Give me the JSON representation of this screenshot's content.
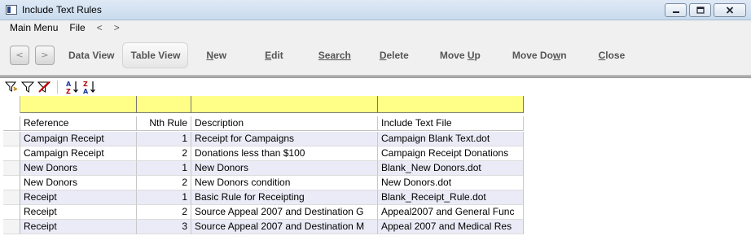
{
  "window": {
    "title": "Include Text Rules",
    "minimize_icon": "minimize-icon",
    "maximize_icon": "maximize-icon",
    "close_icon": "close-icon"
  },
  "menubar": {
    "items": [
      "Main Menu",
      "File"
    ],
    "back_arrow": "<",
    "forward_arrow": ">"
  },
  "toolbar": {
    "prev": "<",
    "next": ">",
    "data_view": "Data View",
    "table_view": "Table View",
    "new_u": "N",
    "new_rest": "ew",
    "edit_u": "E",
    "edit_rest": "dit",
    "search_u": "S",
    "search_rest": "earch",
    "delete_u": "D",
    "delete_rest": "elete",
    "moveup_pre": "Move ",
    "moveup_u": "U",
    "moveup_rest": "p",
    "movedown_pre": "Move Do",
    "movedown_u": "w",
    "movedown_rest": "n",
    "close_u": "C",
    "close_rest": "lose"
  },
  "filterbar": {
    "icons": [
      "auto-filter-icon",
      "filter-icon",
      "clear-filter-icon",
      "sort-ascending-icon",
      "sort-descending-icon"
    ]
  },
  "table": {
    "columns": [
      "Reference",
      "Nth Rule",
      "Description",
      "Include Text File"
    ],
    "rows": [
      [
        "Campaign Receipt",
        "1",
        "Receipt for Campaigns",
        "Campaign Blank Text.dot"
      ],
      [
        "Campaign Receipt",
        "2",
        "Donations less than $100",
        "Campaign Receipt Donations"
      ],
      [
        "New Donors",
        "1",
        "New Donors",
        "Blank_New Donors.dot"
      ],
      [
        "New Donors",
        "2",
        "New Donors condition",
        "New Donors.dot"
      ],
      [
        "Receipt",
        "1",
        "Basic Rule for Receipting",
        "Blank_Receipt_Rule.dot"
      ],
      [
        "Receipt",
        "2",
        "Source Appeal 2007 and Destination G",
        "Appeal2007 and General Func"
      ],
      [
        "Receipt",
        "3",
        "Source Appeal 2007 and Destination M",
        "Appeal 2007 and Medical Res"
      ]
    ]
  },
  "colors": {
    "filter_row": "#ffff88",
    "alt_row": "#ebebf7",
    "title_bar": "#c9dbee"
  }
}
